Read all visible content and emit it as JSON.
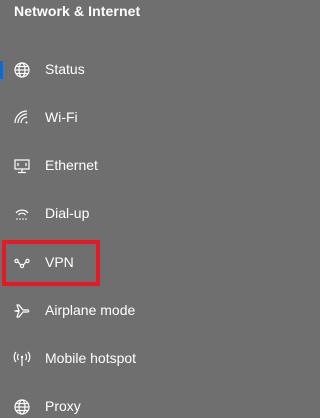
{
  "header": {
    "title": "Network & Internet"
  },
  "nav": {
    "items": [
      {
        "label": "Status",
        "icon": "globe-icon",
        "selected": true
      },
      {
        "label": "Wi-Fi",
        "icon": "wifi-icon"
      },
      {
        "label": "Ethernet",
        "icon": "ethernet-icon"
      },
      {
        "label": "Dial-up",
        "icon": "dialup-icon"
      },
      {
        "label": "VPN",
        "icon": "vpn-icon",
        "highlighted": true
      },
      {
        "label": "Airplane mode",
        "icon": "airplane-icon"
      },
      {
        "label": "Mobile hotspot",
        "icon": "hotspot-icon"
      },
      {
        "label": "Proxy",
        "icon": "globe-icon"
      }
    ]
  },
  "colors": {
    "background": "#6f6f6f",
    "text": "#ffffff",
    "selected_indicator": "#1a66c5",
    "highlight_box": "#e51a24"
  }
}
